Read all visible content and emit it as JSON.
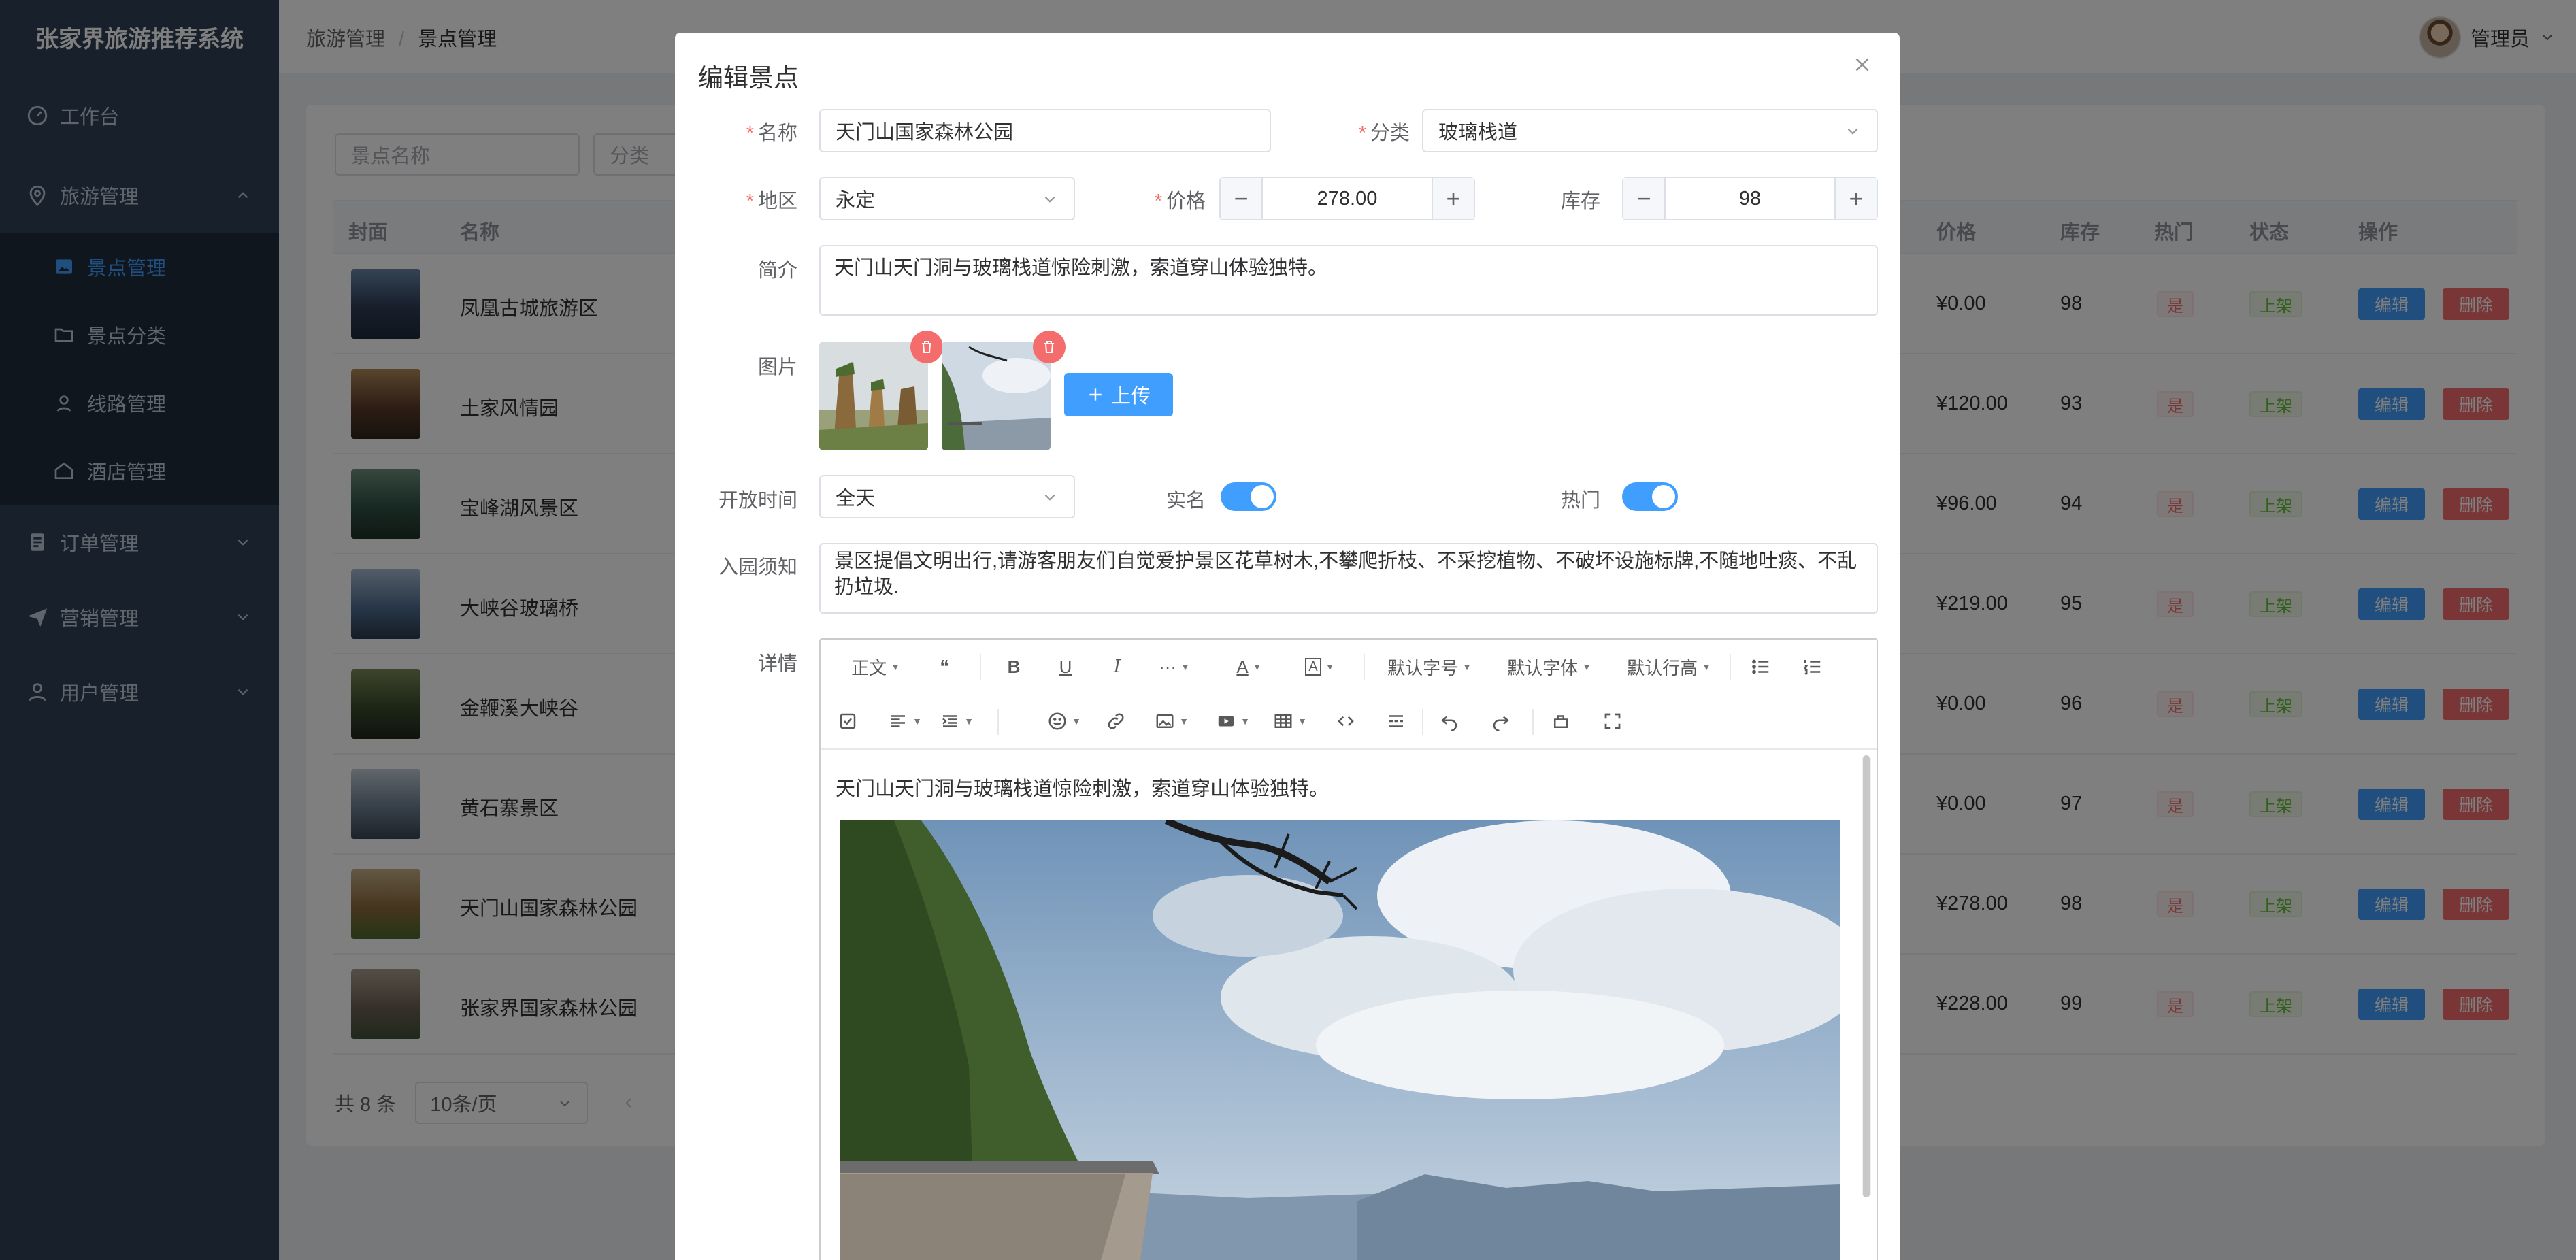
{
  "app": {
    "title": "张家界旅游推荐系统"
  },
  "sidebar": {
    "items": [
      {
        "label": "工作台"
      },
      {
        "label": "旅游管理"
      },
      {
        "label": "景点管理"
      },
      {
        "label": "景点分类"
      },
      {
        "label": "线路管理"
      },
      {
        "label": "酒店管理"
      },
      {
        "label": "订单管理"
      },
      {
        "label": "营销管理"
      },
      {
        "label": "用户管理"
      }
    ]
  },
  "header": {
    "breadcrumb": [
      "旅游管理",
      "景点管理"
    ],
    "breadcrumb_sep": "/",
    "user_name": "管理员"
  },
  "filters": {
    "name_placeholder": "景点名称",
    "category_placeholder": "分类"
  },
  "table": {
    "columns": {
      "cover": "封面",
      "name": "名称",
      "price": "价格",
      "stock": "库存",
      "hot": "热门",
      "status": "状态",
      "actions": "操作"
    },
    "rows": [
      {
        "name": "凤凰古城旅游区",
        "price": "¥0.00",
        "stock": "98",
        "hot": "是",
        "status": "上架"
      },
      {
        "name": "土家风情园",
        "price": "¥120.00",
        "stock": "93",
        "hot": "是",
        "status": "上架"
      },
      {
        "name": "宝峰湖风景区",
        "price": "¥96.00",
        "stock": "94",
        "hot": "是",
        "status": "上架"
      },
      {
        "name": "大峡谷玻璃桥",
        "price": "¥219.00",
        "stock": "95",
        "hot": "是",
        "status": "上架"
      },
      {
        "name": "金鞭溪大峡谷",
        "price": "¥0.00",
        "stock": "96",
        "hot": "是",
        "status": "上架"
      },
      {
        "name": "黄石寨景区",
        "price": "¥0.00",
        "stock": "97",
        "hot": "是",
        "status": "上架"
      },
      {
        "name": "天门山国家森林公园",
        "price": "¥278.00",
        "stock": "98",
        "hot": "是",
        "status": "上架"
      },
      {
        "name": "张家界国家森林公园",
        "price": "¥228.00",
        "stock": "99",
        "hot": "是",
        "status": "上架"
      }
    ],
    "edit_label": "编辑",
    "delete_label": "删除"
  },
  "pager": {
    "total": "共 8 条",
    "page_size": "10条/页"
  },
  "dialog": {
    "title": "编辑景点",
    "name_label": "名称",
    "name_value": "天门山国家森林公园",
    "category_label": "分类",
    "category_value": "玻璃栈道",
    "region_label": "地区",
    "region_value": "永定",
    "price_label": "价格",
    "price_value": "278.00",
    "stock_label": "库存",
    "stock_value": "98",
    "intro_label": "简介",
    "intro_value": "天门山天门洞与玻璃栈道惊险刺激，索道穿山体验独特。",
    "images_label": "图片",
    "upload_label": "上传",
    "open_time_label": "开放时间",
    "open_time_value": "全天",
    "realname_label": "实名",
    "realname_on": true,
    "hot_label": "热门",
    "hot_on": true,
    "notice_label": "入园须知",
    "notice_value": "景区提倡文明出行,请游客朋友们自觉爱护景区花草树木,不攀爬折枝、不采挖植物、不破坏设施标牌,不随地吐痰、不乱扔垃圾.",
    "detail_label": "详情",
    "editor": {
      "paragraph": "正文",
      "font_size": "默认字号",
      "font_family": "默认字体",
      "line_height": "默认行高",
      "content_text": "天门山天门洞与玻璃栈道惊险刺激，索道穿山体验独特。"
    }
  },
  "colors": {
    "primary": "#409eff",
    "danger": "#f56c6c",
    "success": "#67c23a",
    "sidebar_bg": "#304156"
  }
}
